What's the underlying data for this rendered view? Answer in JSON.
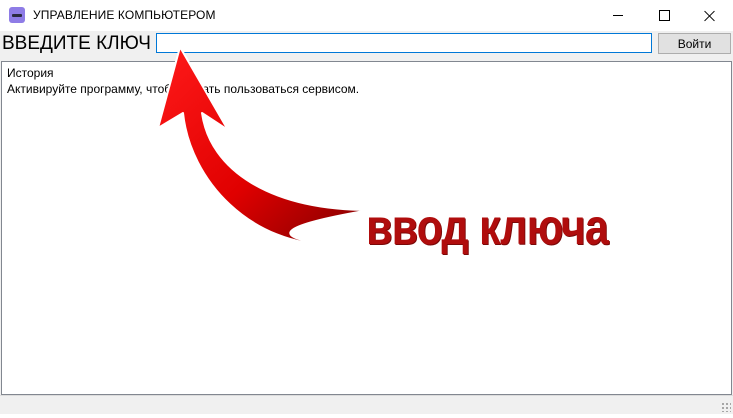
{
  "window": {
    "title": "УПРАВЛЕНИЕ КОМПЬЮТЕРОМ",
    "app_icon": "app-icon",
    "controls": [
      "minimize-icon",
      "maximize-icon",
      "close-icon"
    ]
  },
  "key_row": {
    "label": "ВВЕДИТЕ КЛЮЧ",
    "input_value": "",
    "login_button": "Войти"
  },
  "history": {
    "title": "История",
    "message": "Активируйте программу, чтобы начать пользоваться сервисом."
  },
  "annotation": {
    "text": "ввод ключа",
    "color": "#b00d0d"
  }
}
